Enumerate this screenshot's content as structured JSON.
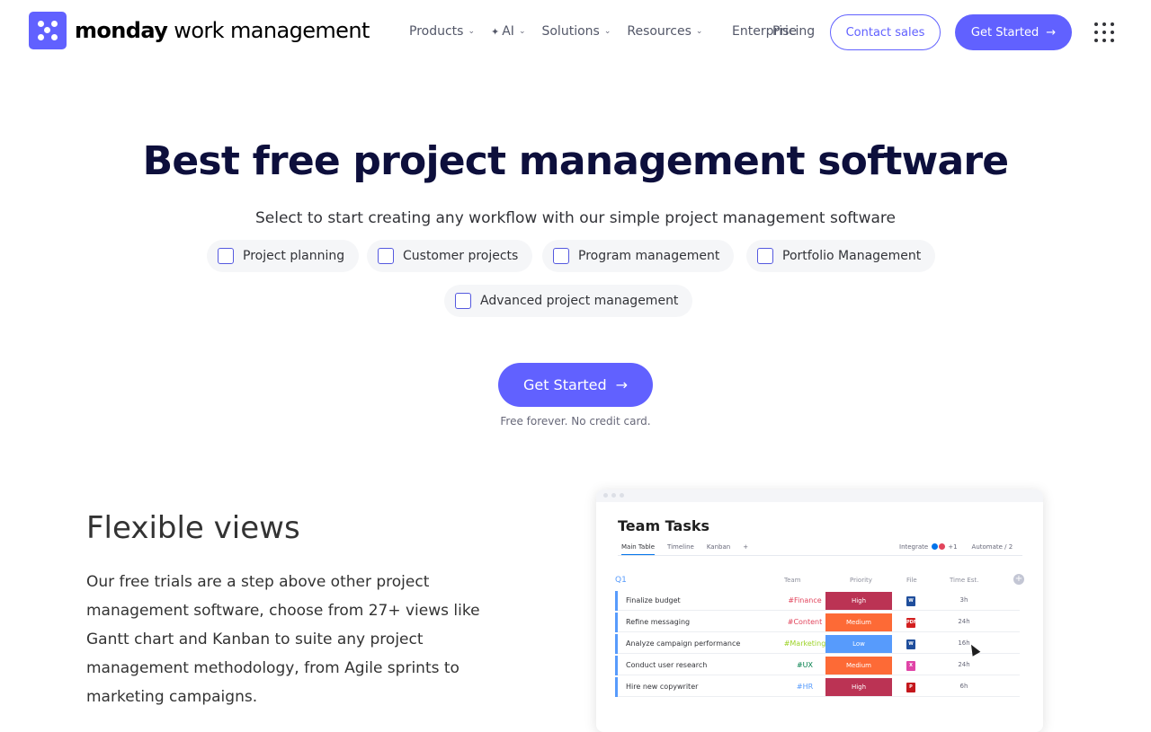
{
  "nav": {
    "logo_bold": "monday",
    "logo_rest": " work management",
    "items": [
      {
        "label": "Products"
      },
      {
        "label": "AI"
      },
      {
        "label": "Solutions"
      },
      {
        "label": "Resources"
      }
    ],
    "enterprise": "Enterprise",
    "pricing": "Pricing",
    "contact_sales": "Contact sales",
    "get_started": "Get Started"
  },
  "hero": {
    "title": "Best free project management software",
    "subtitle": "Select to start creating any workflow with our simple project management software",
    "options": [
      {
        "label": "Project planning",
        "checked": false
      },
      {
        "label": "Customer projects",
        "checked": false
      },
      {
        "label": "Program management",
        "checked": false
      },
      {
        "label": "Portfolio Management",
        "checked": false
      },
      {
        "label": "Advanced project management",
        "checked": false
      }
    ],
    "cta": "Get Started",
    "note": "Free forever. No credit card."
  },
  "feature": {
    "title": "Flexible views",
    "text": "Our free trials are a step above other project management software, choose from 27+ views like Gantt chart and Kanban to suite any project management methodology, from Agile sprints to marketing campaigns."
  },
  "mockup": {
    "title": "Team Tasks",
    "tabs": [
      "Main Table",
      "Timeline",
      "Kanban",
      "+"
    ],
    "right_tools": [
      "Integrate",
      "+1",
      "Automate / 2"
    ],
    "group": "Q1",
    "columns": {
      "team": "Team",
      "priority": "Priority",
      "file": "File",
      "time": "Time Est."
    },
    "rows": [
      {
        "name": "Finalize budget",
        "team": "#Finance",
        "team_color": "#e2445c",
        "priority": "High",
        "priority_color": "#bb3354",
        "file": "W",
        "file_color": "#1f4e9c",
        "time": "3h"
      },
      {
        "name": "Refine messaging",
        "team": "#Content",
        "team_color": "#e2445c",
        "priority": "Medium",
        "priority_color": "#fd6a36",
        "file": "PDF",
        "file_color": "#d31f1f",
        "time": "24h"
      },
      {
        "name": "Analyze campaign performance",
        "team": "#Marketing",
        "team_color": "#9cd326",
        "priority": "Low",
        "priority_color": "#579bfc",
        "file": "W",
        "file_color": "#1f4e9c",
        "time": "16h"
      },
      {
        "name": "Conduct user research",
        "team": "#UX",
        "team_color": "#037f4c",
        "priority": "Medium",
        "priority_color": "#fd6a36",
        "file": "X",
        "file_color": "#e044a7",
        "time": "24h"
      },
      {
        "name": "Hire new copywriter",
        "team": "#HR",
        "team_color": "#579bfc",
        "priority": "High",
        "priority_color": "#bb3354",
        "file": "P",
        "file_color": "#c4171c",
        "time": "6h"
      }
    ]
  },
  "colors": {
    "brand": "#6161ff",
    "heading": "#0d0f3c"
  }
}
